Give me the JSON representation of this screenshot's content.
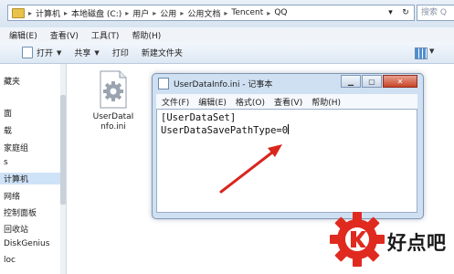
{
  "address_bar": {
    "crumbs": [
      "计算机",
      "本地磁盘 (C:)",
      "用户",
      "公用",
      "公用文档",
      "Tencent",
      "QQ"
    ],
    "search_placeholder": "搜索 Q"
  },
  "menu": [
    "编辑(E)",
    "查看(V)",
    "工具(T)",
    "帮助(H)"
  ],
  "toolbar": {
    "open_label": "打开",
    "share_label": "共享",
    "print_label": "打印",
    "new_folder_label": "新建文件夹"
  },
  "sidebar": {
    "items": [
      "藏夹",
      "面",
      "载",
      "家庭组",
      "s",
      "计算机",
      "网络",
      "控制面板",
      "回收站",
      "DiskGenius",
      "loc"
    ],
    "selected_index": 5
  },
  "file": {
    "name_line1": "UserDataI",
    "name_line2": "nfo.ini"
  },
  "notepad": {
    "title": "UserDataInfo.ini - 记事本",
    "menu": [
      "文件(F)",
      "编辑(E)",
      "格式(O)",
      "查看(V)",
      "帮助(H)"
    ],
    "lines": [
      "[UserDataSet]",
      "UserDataSavePathType=0"
    ]
  },
  "watermark": {
    "text": "好点吧"
  },
  "colors": {
    "arrow": "#d9261c",
    "watermark_red": "#e02a1f"
  }
}
